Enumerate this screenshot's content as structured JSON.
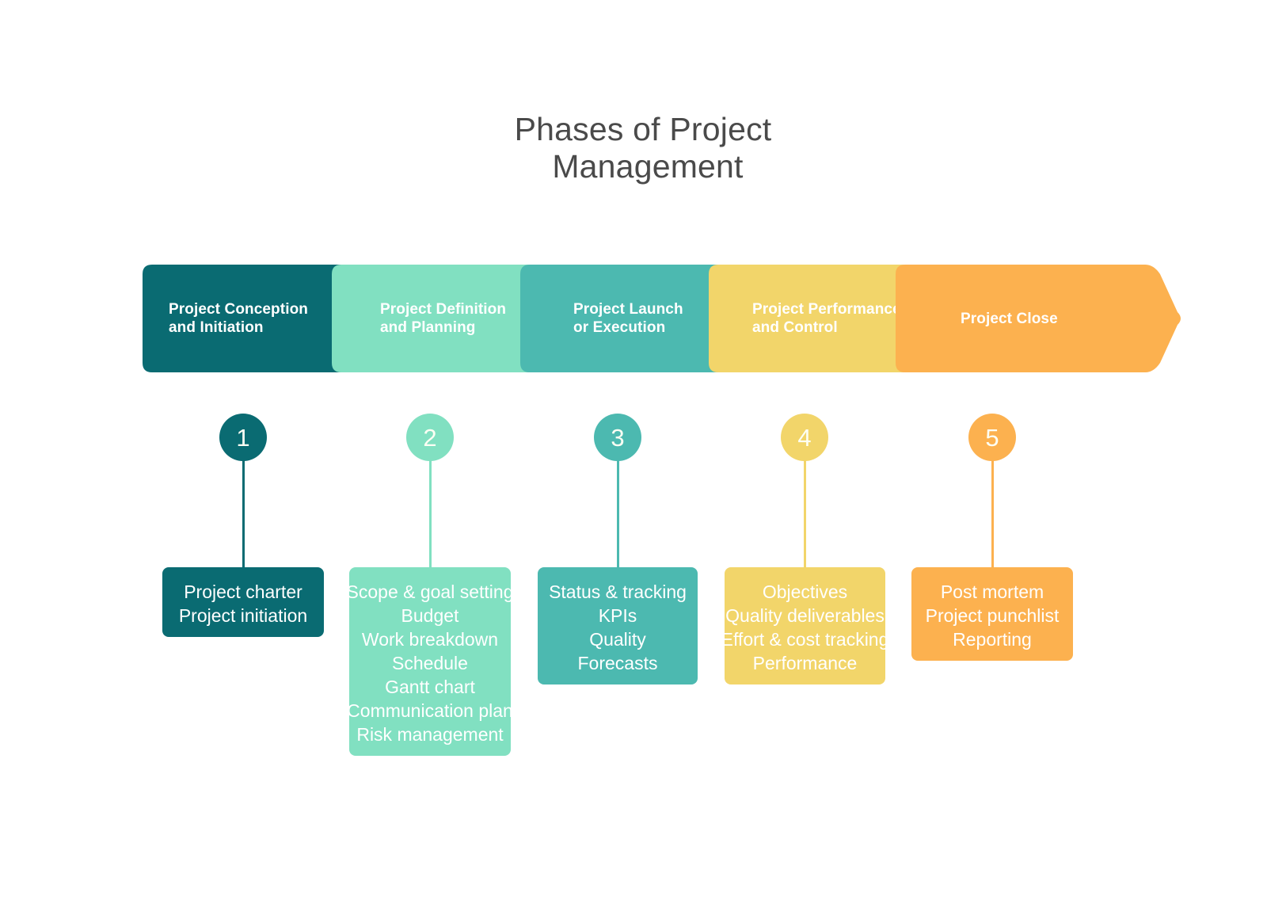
{
  "title": {
    "line1": "Phases of Project",
    "line2": "Management"
  },
  "colors": {
    "phase1": "#0a6b72",
    "phase2": "#81e0c1",
    "phase3": "#4cb9b0",
    "phase4": "#f2d56a",
    "phase5": "#fcb14f",
    "title_text": "#4a4a4a",
    "background": "#ffffff",
    "label_text": "#ffffff"
  },
  "phases": [
    {
      "number": "1",
      "banner_label": "Project Conception\nand Initiation",
      "color": "#0a6b72",
      "items": [
        "Project charter",
        "Project initiation"
      ]
    },
    {
      "number": "2",
      "banner_label": "Project Definition\nand Planning",
      "color": "#81e0c1",
      "items": [
        "Scope & goal setting",
        "Budget",
        "Work breakdown",
        "Schedule",
        "Gantt chart",
        "Communication plan",
        "Risk management"
      ]
    },
    {
      "number": "3",
      "banner_label": "Project Launch\nor Execution",
      "color": "#4cb9b0",
      "items": [
        "Status & tracking",
        "KPIs",
        "Quality",
        "Forecasts"
      ]
    },
    {
      "number": "4",
      "banner_label": "Project Performance\nand Control",
      "color": "#f2d56a",
      "items": [
        "Objectives",
        "Quality deliverables",
        "Effort & cost tracking",
        "Performance"
      ]
    },
    {
      "number": "5",
      "banner_label": "Project Close",
      "color": "#fcb14f",
      "items": [
        "Post mortem",
        "Project punchlist",
        "Reporting"
      ]
    }
  ]
}
